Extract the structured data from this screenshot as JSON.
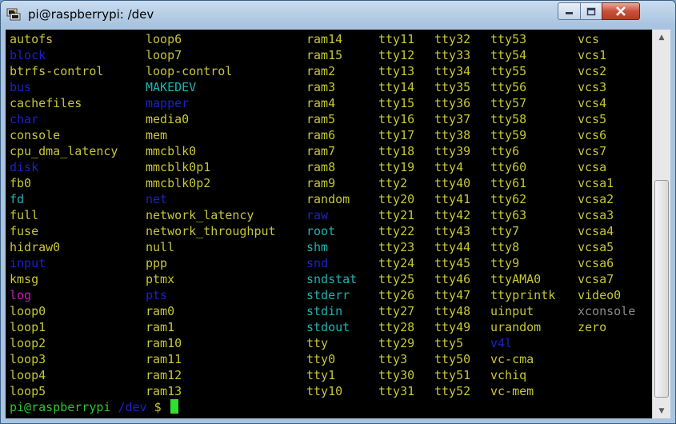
{
  "window": {
    "title": "pi@raspberrypi: /dev"
  },
  "columns": [
    [
      {
        "t": "autofs",
        "c": "plain"
      },
      {
        "t": "block",
        "c": "dir"
      },
      {
        "t": "btrfs-control",
        "c": "plain"
      },
      {
        "t": "bus",
        "c": "dir"
      },
      {
        "t": "cachefiles",
        "c": "plain"
      },
      {
        "t": "char",
        "c": "dir"
      },
      {
        "t": "console",
        "c": "plain"
      },
      {
        "t": "cpu_dma_latency",
        "c": "plain"
      },
      {
        "t": "disk",
        "c": "dir"
      },
      {
        "t": "fb0",
        "c": "plain"
      },
      {
        "t": "fd",
        "c": "link"
      },
      {
        "t": "full",
        "c": "plain"
      },
      {
        "t": "fuse",
        "c": "plain"
      },
      {
        "t": "hidraw0",
        "c": "plain"
      },
      {
        "t": "input",
        "c": "dir"
      },
      {
        "t": "kmsg",
        "c": "plain"
      },
      {
        "t": "log",
        "c": "pink"
      },
      {
        "t": "loop0",
        "c": "plain"
      },
      {
        "t": "loop1",
        "c": "plain"
      },
      {
        "t": "loop2",
        "c": "plain"
      },
      {
        "t": "loop3",
        "c": "plain"
      },
      {
        "t": "loop4",
        "c": "plain"
      },
      {
        "t": "loop5",
        "c": "plain"
      }
    ],
    [
      {
        "t": "loop6",
        "c": "plain"
      },
      {
        "t": "loop7",
        "c": "plain"
      },
      {
        "t": "loop-control",
        "c": "plain"
      },
      {
        "t": "MAKEDEV",
        "c": "link"
      },
      {
        "t": "mapper",
        "c": "dir"
      },
      {
        "t": "media0",
        "c": "plain"
      },
      {
        "t": "mem",
        "c": "plain"
      },
      {
        "t": "mmcblk0",
        "c": "plain"
      },
      {
        "t": "mmcblk0p1",
        "c": "plain"
      },
      {
        "t": "mmcblk0p2",
        "c": "plain"
      },
      {
        "t": "net",
        "c": "dir"
      },
      {
        "t": "network_latency",
        "c": "plain"
      },
      {
        "t": "network_throughput",
        "c": "plain"
      },
      {
        "t": "null",
        "c": "plain"
      },
      {
        "t": "ppp",
        "c": "plain"
      },
      {
        "t": "ptmx",
        "c": "plain"
      },
      {
        "t": "pts",
        "c": "dir"
      },
      {
        "t": "ram0",
        "c": "plain"
      },
      {
        "t": "ram1",
        "c": "plain"
      },
      {
        "t": "ram10",
        "c": "plain"
      },
      {
        "t": "ram11",
        "c": "plain"
      },
      {
        "t": "ram12",
        "c": "plain"
      },
      {
        "t": "ram13",
        "c": "plain"
      }
    ],
    [
      {
        "t": "ram14",
        "c": "plain"
      },
      {
        "t": "ram15",
        "c": "plain"
      },
      {
        "t": "ram2",
        "c": "plain"
      },
      {
        "t": "ram3",
        "c": "plain"
      },
      {
        "t": "ram4",
        "c": "plain"
      },
      {
        "t": "ram5",
        "c": "plain"
      },
      {
        "t": "ram6",
        "c": "plain"
      },
      {
        "t": "ram7",
        "c": "plain"
      },
      {
        "t": "ram8",
        "c": "plain"
      },
      {
        "t": "ram9",
        "c": "plain"
      },
      {
        "t": "random",
        "c": "plain"
      },
      {
        "t": "raw",
        "c": "dir"
      },
      {
        "t": "root",
        "c": "link"
      },
      {
        "t": "shm",
        "c": "link"
      },
      {
        "t": "snd",
        "c": "dir"
      },
      {
        "t": "sndstat",
        "c": "link"
      },
      {
        "t": "stderr",
        "c": "link"
      },
      {
        "t": "stdin",
        "c": "link"
      },
      {
        "t": "stdout",
        "c": "link"
      },
      {
        "t": "tty",
        "c": "plain"
      },
      {
        "t": "tty0",
        "c": "plain"
      },
      {
        "t": "tty1",
        "c": "plain"
      },
      {
        "t": "tty10",
        "c": "plain"
      }
    ],
    [
      {
        "t": "tty11",
        "c": "plain"
      },
      {
        "t": "tty12",
        "c": "plain"
      },
      {
        "t": "tty13",
        "c": "plain"
      },
      {
        "t": "tty14",
        "c": "plain"
      },
      {
        "t": "tty15",
        "c": "plain"
      },
      {
        "t": "tty16",
        "c": "plain"
      },
      {
        "t": "tty17",
        "c": "plain"
      },
      {
        "t": "tty18",
        "c": "plain"
      },
      {
        "t": "tty19",
        "c": "plain"
      },
      {
        "t": "tty2",
        "c": "plain"
      },
      {
        "t": "tty20",
        "c": "plain"
      },
      {
        "t": "tty21",
        "c": "plain"
      },
      {
        "t": "tty22",
        "c": "plain"
      },
      {
        "t": "tty23",
        "c": "plain"
      },
      {
        "t": "tty24",
        "c": "plain"
      },
      {
        "t": "tty25",
        "c": "plain"
      },
      {
        "t": "tty26",
        "c": "plain"
      },
      {
        "t": "tty27",
        "c": "plain"
      },
      {
        "t": "tty28",
        "c": "plain"
      },
      {
        "t": "tty29",
        "c": "plain"
      },
      {
        "t": "tty3",
        "c": "plain"
      },
      {
        "t": "tty30",
        "c": "plain"
      },
      {
        "t": "tty31",
        "c": "plain"
      }
    ],
    [
      {
        "t": "tty32",
        "c": "plain"
      },
      {
        "t": "tty33",
        "c": "plain"
      },
      {
        "t": "tty34",
        "c": "plain"
      },
      {
        "t": "tty35",
        "c": "plain"
      },
      {
        "t": "tty36",
        "c": "plain"
      },
      {
        "t": "tty37",
        "c": "plain"
      },
      {
        "t": "tty38",
        "c": "plain"
      },
      {
        "t": "tty39",
        "c": "plain"
      },
      {
        "t": "tty4",
        "c": "plain"
      },
      {
        "t": "tty40",
        "c": "plain"
      },
      {
        "t": "tty41",
        "c": "plain"
      },
      {
        "t": "tty42",
        "c": "plain"
      },
      {
        "t": "tty43",
        "c": "plain"
      },
      {
        "t": "tty44",
        "c": "plain"
      },
      {
        "t": "tty45",
        "c": "plain"
      },
      {
        "t": "tty46",
        "c": "plain"
      },
      {
        "t": "tty47",
        "c": "plain"
      },
      {
        "t": "tty48",
        "c": "plain"
      },
      {
        "t": "tty49",
        "c": "plain"
      },
      {
        "t": "tty5",
        "c": "plain"
      },
      {
        "t": "tty50",
        "c": "plain"
      },
      {
        "t": "tty51",
        "c": "plain"
      },
      {
        "t": "tty52",
        "c": "plain"
      }
    ],
    [
      {
        "t": "tty53",
        "c": "plain"
      },
      {
        "t": "tty54",
        "c": "plain"
      },
      {
        "t": "tty55",
        "c": "plain"
      },
      {
        "t": "tty56",
        "c": "plain"
      },
      {
        "t": "tty57",
        "c": "plain"
      },
      {
        "t": "tty58",
        "c": "plain"
      },
      {
        "t": "tty59",
        "c": "plain"
      },
      {
        "t": "tty6",
        "c": "plain"
      },
      {
        "t": "tty60",
        "c": "plain"
      },
      {
        "t": "tty61",
        "c": "plain"
      },
      {
        "t": "tty62",
        "c": "plain"
      },
      {
        "t": "tty63",
        "c": "plain"
      },
      {
        "t": "tty7",
        "c": "plain"
      },
      {
        "t": "tty8",
        "c": "plain"
      },
      {
        "t": "tty9",
        "c": "plain"
      },
      {
        "t": "ttyAMA0",
        "c": "plain"
      },
      {
        "t": "ttyprintk",
        "c": "plain"
      },
      {
        "t": "uinput",
        "c": "plain"
      },
      {
        "t": "urandom",
        "c": "plain"
      },
      {
        "t": "v4l",
        "c": "dir"
      },
      {
        "t": "vc-cma",
        "c": "plain"
      },
      {
        "t": "vchiq",
        "c": "plain"
      },
      {
        "t": "vc-mem",
        "c": "plain"
      }
    ],
    [
      {
        "t": "vcs",
        "c": "plain"
      },
      {
        "t": "vcs1",
        "c": "plain"
      },
      {
        "t": "vcs2",
        "c": "plain"
      },
      {
        "t": "vcs3",
        "c": "plain"
      },
      {
        "t": "vcs4",
        "c": "plain"
      },
      {
        "t": "vcs5",
        "c": "plain"
      },
      {
        "t": "vcs6",
        "c": "plain"
      },
      {
        "t": "vcs7",
        "c": "plain"
      },
      {
        "t": "vcsa",
        "c": "plain"
      },
      {
        "t": "vcsa1",
        "c": "plain"
      },
      {
        "t": "vcsa2",
        "c": "plain"
      },
      {
        "t": "vcsa3",
        "c": "plain"
      },
      {
        "t": "vcsa4",
        "c": "plain"
      },
      {
        "t": "vcsa5",
        "c": "plain"
      },
      {
        "t": "vcsa6",
        "c": "plain"
      },
      {
        "t": "vcsa7",
        "c": "plain"
      },
      {
        "t": "video0",
        "c": "plain"
      },
      {
        "t": "xconsole",
        "c": "gray"
      },
      {
        "t": "zero",
        "c": "plain"
      }
    ]
  ],
  "prompt": {
    "host": "pi@raspberrypi",
    "path": " /dev",
    "symbol": " $"
  },
  "colors": {
    "plain": "#c6c636",
    "dir": "#1b22c8",
    "link": "#1fb3b3",
    "pink": "#c31cc3",
    "prompt": "#2ec42e",
    "cursor": "#2ee02e",
    "background": "#000000"
  },
  "icons": {
    "app": "putty-icon",
    "minimize": "minimize-icon",
    "maximize": "maximize-icon",
    "close": "close-icon"
  }
}
